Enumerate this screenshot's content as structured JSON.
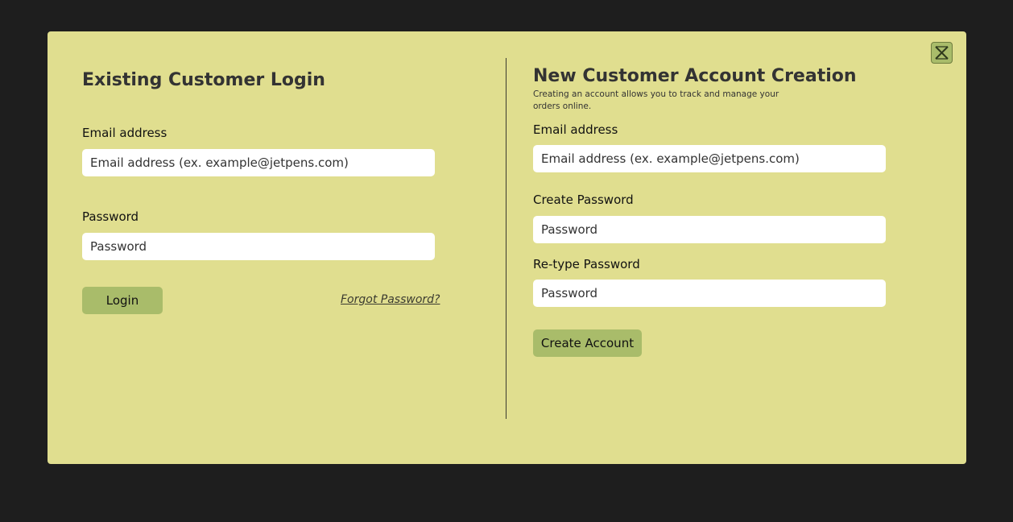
{
  "close_button": {
    "icon": "close-x-icon"
  },
  "login": {
    "heading": "Existing Customer Login",
    "email_label": "Email address",
    "email_placeholder": "Email address (ex. example@jetpens.com)",
    "password_label": "Password",
    "password_placeholder": "Password",
    "login_button": "Login",
    "forgot_link": "Forgot Password?"
  },
  "signup": {
    "heading": "New Customer Account Creation",
    "subtext": "Creating an account allows you to track and manage your orders online.",
    "email_label": "Email address",
    "email_placeholder": "Email address (ex. example@jetpens.com)",
    "create_password_label": "Create Password",
    "create_password_placeholder": "Password",
    "retype_password_label": "Re-type Password",
    "retype_password_placeholder": "Password",
    "create_button": "Create Account"
  },
  "colors": {
    "backdrop": "#1e1e1e",
    "modal": "#e0de8f",
    "accent": "#a9bc6a",
    "text": "#333333"
  }
}
